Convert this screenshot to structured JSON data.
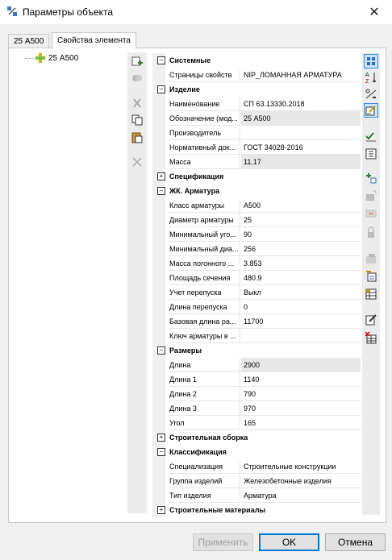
{
  "window": {
    "title": "Параметры объекта"
  },
  "tabs": [
    {
      "label": "25 А500"
    },
    {
      "label": "Свойства элемента"
    }
  ],
  "tree": {
    "item_label": "25 А500"
  },
  "grid": {
    "rows": [
      {
        "kind": "cat",
        "label": "Системные",
        "state": "−"
      },
      {
        "kind": "prop",
        "label": "Страницы свойств",
        "value": "NIP_ЛОМАННАЯ АРМАТУРА"
      },
      {
        "kind": "cat",
        "label": "Изделие",
        "state": "−"
      },
      {
        "kind": "prop",
        "label": "Наименование",
        "value": "СП 63.13330.2018"
      },
      {
        "kind": "prop",
        "label": "Обозначение (мод...",
        "value": "25 А500",
        "ro": true
      },
      {
        "kind": "prop",
        "label": "Производитель",
        "value": ""
      },
      {
        "kind": "prop",
        "label": "Нормативный док...",
        "value": "ГОСТ 34028-2016"
      },
      {
        "kind": "prop",
        "label": "Масса",
        "value": "11.17",
        "ro": true
      },
      {
        "kind": "cat",
        "label": "Спецификация",
        "state": "+"
      },
      {
        "kind": "cat",
        "label": "ЖК. Арматура",
        "state": "−"
      },
      {
        "kind": "prop",
        "label": "Класс арматуры",
        "value": "А500"
      },
      {
        "kind": "prop",
        "label": "Диаметр арматуры",
        "value": "25"
      },
      {
        "kind": "prop",
        "label": "Минимальный уго...",
        "value": "90"
      },
      {
        "kind": "prop",
        "label": "Минимальный диа...",
        "value": "256"
      },
      {
        "kind": "prop",
        "label": "Масса погонного ...",
        "value": "3.853"
      },
      {
        "kind": "prop",
        "label": "Площадь сечения",
        "value": "480.9"
      },
      {
        "kind": "prop",
        "label": "Учет перепуска",
        "value": "Выкл"
      },
      {
        "kind": "prop",
        "label": "Длина перепуска",
        "value": "0"
      },
      {
        "kind": "prop",
        "label": "Базовая длина ра...",
        "value": "11700"
      },
      {
        "kind": "prop",
        "label": "Ключ арматуры в ...",
        "value": ""
      },
      {
        "kind": "cat",
        "label": "Размеры",
        "state": "−"
      },
      {
        "kind": "prop",
        "label": "Длина",
        "value": "2900",
        "ro": true
      },
      {
        "kind": "prop",
        "label": "Длина 1",
        "value": "1140"
      },
      {
        "kind": "prop",
        "label": "Длина 2",
        "value": "790"
      },
      {
        "kind": "prop",
        "label": "Длина 3",
        "value": "970"
      },
      {
        "kind": "prop",
        "label": "Угол",
        "value": "165"
      },
      {
        "kind": "cat",
        "label": "Строительная сборка",
        "state": "+"
      },
      {
        "kind": "cat",
        "label": "Классификация",
        "state": "−"
      },
      {
        "kind": "prop",
        "label": "Специализация",
        "value": "Строительные конструкции"
      },
      {
        "kind": "prop",
        "label": "Группа изделий",
        "value": "Железобетонные изделия"
      },
      {
        "kind": "prop",
        "label": "Тип изделия",
        "value": "Арматура"
      },
      {
        "kind": "cat",
        "label": "Строительные материалы",
        "state": "+"
      }
    ]
  },
  "buttons": {
    "apply": "Применить",
    "ok": "OK",
    "cancel": "Отмена"
  },
  "colors": {
    "accent": "#0078d7",
    "readonly_bg": "#e8e8e8"
  }
}
